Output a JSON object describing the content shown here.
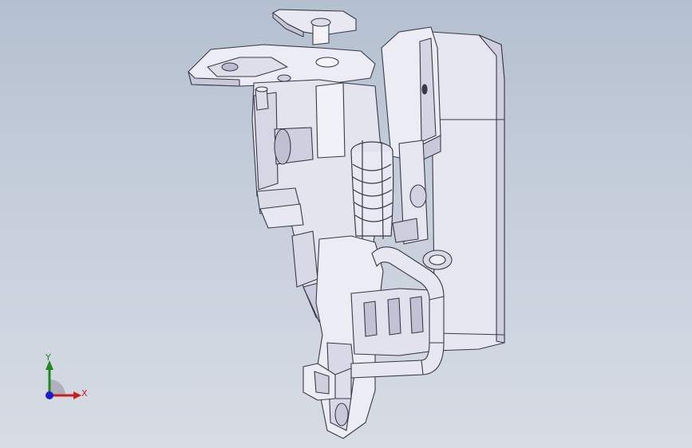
{
  "viewport": {
    "background_top": "#b4c0d0",
    "background_bottom": "#d7dce4",
    "model": "latch-assembly"
  },
  "triad": {
    "y_label": "Y",
    "x_label": "X",
    "y_color": "#1e8a1e",
    "x_color": "#c81e1e",
    "z_color": "#1c1cc8"
  },
  "colors": {
    "part_fill": "#e9e9f3",
    "part_shade": "#c4c4d6",
    "part_dark": "#9a9ab0",
    "edge": "#3a3a48"
  }
}
